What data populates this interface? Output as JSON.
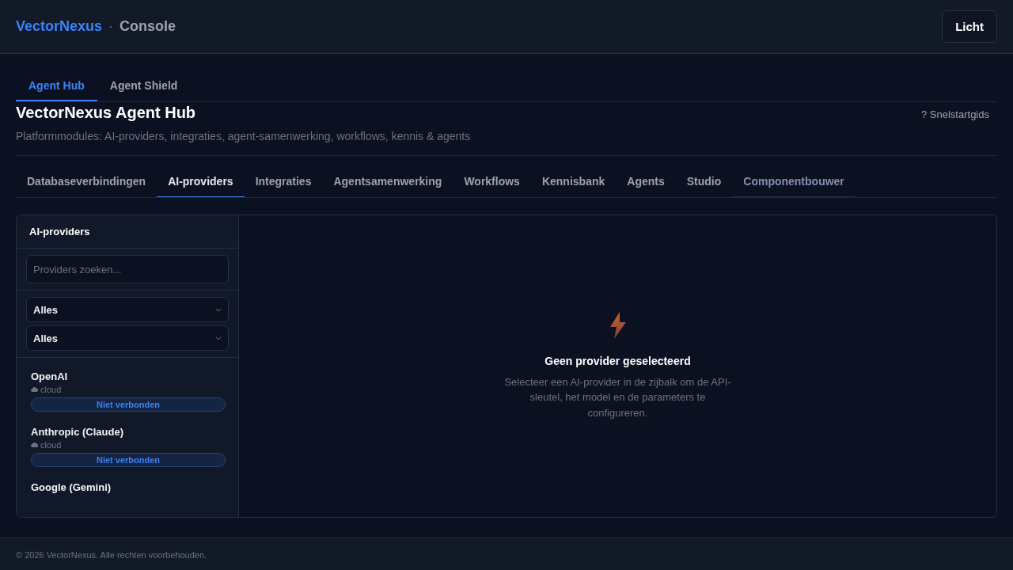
{
  "header": {
    "brand": "VectorNexus",
    "separator": "·",
    "product": "Console",
    "theme_button": "Licht"
  },
  "top_tabs": [
    {
      "label": "Agent Hub",
      "selected": true
    },
    {
      "label": "Agent Shield",
      "selected": false
    }
  ],
  "page": {
    "title": "VectorNexus Agent Hub",
    "subtitle": "Platformmodules: AI-providers, integraties, agent-samenwerking, workflows, kennis & agents",
    "help_link": "? Snelstartgids"
  },
  "module_tabs": [
    {
      "label": "Databaseverbindingen",
      "selected": false,
      "highlighted": false
    },
    {
      "label": "AI-providers",
      "selected": true,
      "highlighted": false
    },
    {
      "label": "Integraties",
      "selected": false,
      "highlighted": false
    },
    {
      "label": "Agentsamenwerking",
      "selected": false,
      "highlighted": false
    },
    {
      "label": "Workflows",
      "selected": false,
      "highlighted": false
    },
    {
      "label": "Kennisbank",
      "selected": false,
      "highlighted": false
    },
    {
      "label": "Agents",
      "selected": false,
      "highlighted": false
    },
    {
      "label": "Studio",
      "selected": false,
      "highlighted": false
    },
    {
      "label": "Componentbouwer",
      "selected": false,
      "highlighted": true
    }
  ],
  "sidebar": {
    "title": "AI-providers",
    "search": {
      "placeholder": "Providers zoeken..."
    },
    "filters": [
      {
        "value": "Alles"
      },
      {
        "value": "Alles"
      }
    ],
    "providers": [
      {
        "name": "OpenAI",
        "type": "cloud",
        "status": "Niet verbonden"
      },
      {
        "name": "Anthropic (Claude)",
        "type": "cloud",
        "status": "Niet verbonden"
      },
      {
        "name": "Google (Gemini)"
      }
    ]
  },
  "empty_state": {
    "title": "Geen provider geselecteerd",
    "message": "Selecteer een AI-provider in de zijbalk om de API-sleutel, het model en de parameters te configureren."
  },
  "footer": "© 2026 VectorNexus. Alle rechten voorbehouden."
}
